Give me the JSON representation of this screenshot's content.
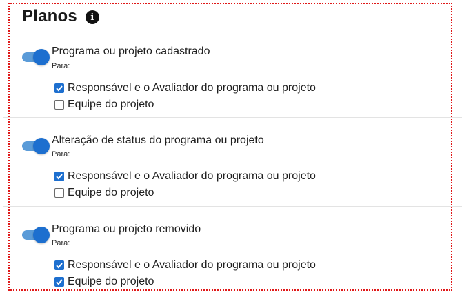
{
  "section": {
    "title": "Planos",
    "info_icon": "info-icon"
  },
  "plans": [
    {
      "title": "Programa ou projeto cadastrado",
      "enabled": true,
      "para_label": "Para:",
      "options": [
        {
          "label": "Responsável e o Avaliador do programa ou projeto",
          "checked": true
        },
        {
          "label": "Equipe do projeto",
          "checked": false
        }
      ]
    },
    {
      "title": "Alteração de status do programa ou projeto",
      "enabled": true,
      "para_label": "Para:",
      "options": [
        {
          "label": "Responsável e o Avaliador do programa ou projeto",
          "checked": true
        },
        {
          "label": "Equipe do projeto",
          "checked": false
        }
      ]
    },
    {
      "title": "Programa ou projeto removido",
      "enabled": true,
      "para_label": "Para:",
      "options": [
        {
          "label": "Responsável e o Avaliador do programa ou projeto",
          "checked": true
        },
        {
          "label": "Equipe do projeto",
          "checked": true
        }
      ]
    }
  ],
  "colors": {
    "accent": "#1d6fcf",
    "toggle_track": "#5a9bd8",
    "frame_outline": "#e01818"
  }
}
